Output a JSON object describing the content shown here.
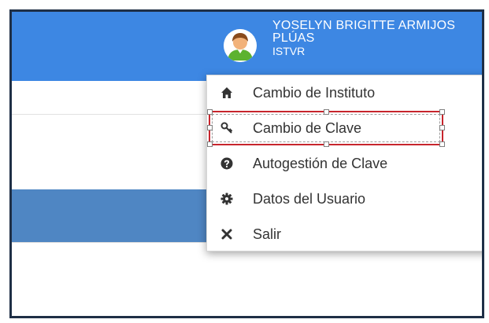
{
  "header": {
    "user_name_line1": "YOSELYN BRIGITTE ARMIJOS",
    "user_name_line2": "PLÚAS",
    "institute": "ISTVR",
    "avatar_icon": "user-avatar-icon"
  },
  "menu": {
    "items": [
      {
        "label": "Cambio de Instituto",
        "icon": "home-icon"
      },
      {
        "label": "Cambio de Clave",
        "icon": "key-icon"
      },
      {
        "label": "Autogestión de Clave",
        "icon": "question-circle-icon"
      },
      {
        "label": "Datos del Usuario",
        "icon": "gear-icon"
      },
      {
        "label": "Salir",
        "icon": "close-icon"
      }
    ],
    "highlighted_item": "Cambio de Clave"
  },
  "colors": {
    "topbar": "#3d87e3",
    "band": "#4f86c3",
    "highlight": "#c7252d",
    "frame": "#1f2f46"
  }
}
